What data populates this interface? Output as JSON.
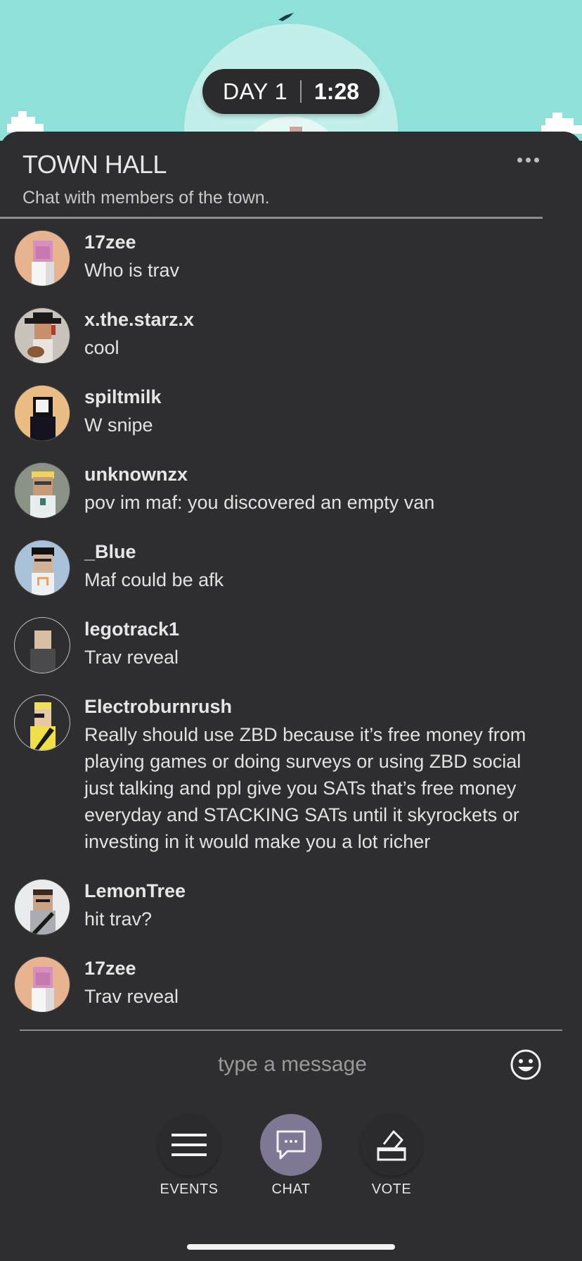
{
  "timer": {
    "day": "DAY 1",
    "time": "1:28"
  },
  "header": {
    "title": "TOWN HALL",
    "subtitle": "Chat with members of the town."
  },
  "messages": [
    {
      "user": "17zee",
      "text": "Who is trav",
      "avatar": "avatar-17zee"
    },
    {
      "user": "x.the.starz.x",
      "text": "cool",
      "avatar": "avatar-x-the-starz-x"
    },
    {
      "user": "spiltmilk",
      "text": "W snipe",
      "avatar": "avatar-spiltmilk"
    },
    {
      "user": "unknownzx",
      "text": "pov im maf: you discovered an empty van",
      "avatar": "avatar-unknownzx"
    },
    {
      "user": "_Blue",
      "text": "Maf could be afk",
      "avatar": "avatar-blue"
    },
    {
      "user": "legotrack1",
      "text": "Trav reveal",
      "avatar": "avatar-legotrack1"
    },
    {
      "user": "Electroburnrush",
      "text": "Really should use ZBD because it’s free money from playing games or doing surveys or using ZBD social just talking and ppl give you SATs that’s free money everyday and STACKING SATs until it skyrockets or investing in it would make you a lot richer",
      "avatar": "avatar-electroburnrush"
    },
    {
      "user": "LemonTree",
      "text": "hit trav?",
      "avatar": "avatar-lemontree"
    },
    {
      "user": "17zee",
      "text": "Trav reveal",
      "avatar": "avatar-17zee"
    }
  ],
  "composer": {
    "placeholder": "type a message",
    "emoji_icon": "smiley-icon"
  },
  "nav": {
    "events": "EVENTS",
    "chat": "CHAT",
    "vote": "VOTE"
  },
  "colors": {
    "sky": "#8fe0d8",
    "panel": "#2e2e30",
    "active_nav": "#7f7894"
  }
}
